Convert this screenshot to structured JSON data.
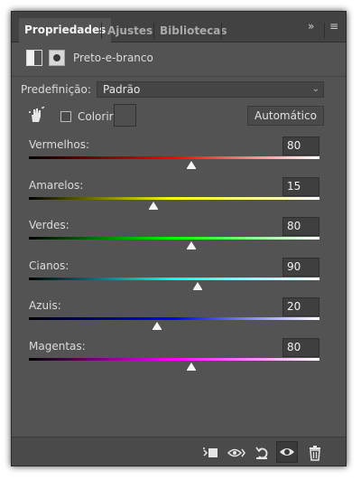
{
  "tabs": [
    {
      "label": "Propriedades",
      "active": true
    },
    {
      "label": "Ajustes",
      "active": false
    },
    {
      "label": "Bibliotecas",
      "active": false
    }
  ],
  "header": {
    "title": "Preto-e-branco"
  },
  "preset": {
    "label": "Predefinição:",
    "value": "Padrão"
  },
  "tint": {
    "label": "Colorir",
    "checked": false
  },
  "auto_button": "Automático",
  "sliders": [
    {
      "label": "Vermelhos:",
      "value": 80,
      "gradient": [
        "#000000",
        "#ff0000",
        "#ffffff"
      ]
    },
    {
      "label": "Amarelos:",
      "value": 15,
      "gradient": [
        "#000000",
        "#ffff00",
        "#ffffff"
      ]
    },
    {
      "label": "Verdes:",
      "value": 80,
      "gradient": [
        "#000000",
        "#00ff00",
        "#ffffff"
      ]
    },
    {
      "label": "Cianos:",
      "value": 90,
      "gradient": [
        "#000000",
        "#00ffff",
        "#ffffff"
      ]
    },
    {
      "label": "Azuis:",
      "value": 20,
      "gradient": [
        "#000000",
        "#0000ff",
        "#ffffff"
      ]
    },
    {
      "label": "Magentas:",
      "value": 80,
      "gradient": [
        "#000000",
        "#ff00ff",
        "#ffffff"
      ]
    }
  ],
  "slider_range": [
    -200,
    300
  ],
  "bottom_icons": [
    "clip-to-layer-icon",
    "view-previous-state-icon",
    "reset-icon",
    "visibility-eye-icon",
    "trash-icon"
  ]
}
